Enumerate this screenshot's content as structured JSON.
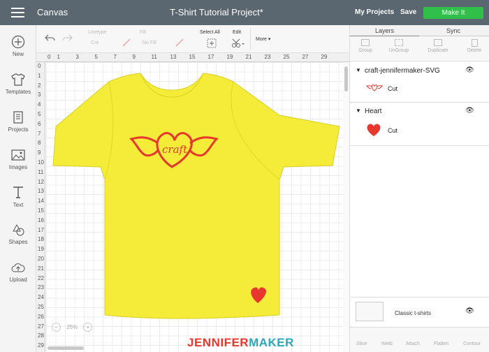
{
  "topbar": {
    "app_title": "Canvas",
    "project_title": "T-Shirt Tutorial Project*",
    "my_projects": "My Projects",
    "save": "Save",
    "make_it": "Make It"
  },
  "sidebar": {
    "items": [
      {
        "label": "New",
        "icon": "plus-circle-icon"
      },
      {
        "label": "Templates",
        "icon": "tshirt-icon"
      },
      {
        "label": "Projects",
        "icon": "book-icon"
      },
      {
        "label": "Images",
        "icon": "image-icon"
      },
      {
        "label": "Text",
        "icon": "text-icon"
      },
      {
        "label": "Shapes",
        "icon": "shapes-icon"
      },
      {
        "label": "Upload",
        "icon": "cloud-upload-icon"
      }
    ]
  },
  "toolbar": {
    "linetype_label": "Linetype",
    "linetype_value": "Cut",
    "fill_label": "Fill",
    "fill_value": "No Fill",
    "select_all": "Select All",
    "edit": "Edit",
    "more": "More"
  },
  "ruler": {
    "top": [
      "0",
      "1",
      "",
      "3",
      "",
      "5",
      "",
      "7",
      "",
      "9",
      "",
      "11",
      "",
      "13",
      "",
      "15",
      "",
      "17",
      "",
      "19",
      "",
      "21",
      "",
      "23",
      "",
      "25",
      "",
      "27",
      "",
      "29",
      ""
    ],
    "left": [
      "0",
      "1",
      "2",
      "3",
      "4",
      "5",
      "6",
      "7",
      "8",
      "9",
      "10",
      "11",
      "12",
      "13",
      "14",
      "15",
      "16",
      "17",
      "18",
      "19",
      "20",
      "21",
      "22",
      "23",
      "24",
      "25",
      "26",
      "27",
      "28",
      "29"
    ]
  },
  "canvas": {
    "shirt_color": "#f5ec3a",
    "design_color": "#e8382e",
    "zoom": "25%"
  },
  "panel": {
    "tabs": [
      {
        "label": "Layers",
        "active": true
      },
      {
        "label": "Sync",
        "active": false
      }
    ],
    "tools": [
      "Group",
      "UnGroup",
      "Duplicate",
      "Delete"
    ],
    "layers": [
      {
        "name": "craft-jennifermaker-SVG",
        "child": "Cut"
      },
      {
        "name": "Heart",
        "child": "Cut"
      }
    ],
    "canvas_layer": "Classic t-shirts",
    "footer_tools": [
      "Slice",
      "Weld",
      "Attach",
      "Flatten",
      "Contour"
    ]
  },
  "branding": {
    "part1": "JENNIFER",
    "part2": "MAKER",
    "color1": "#e8382e",
    "color2": "#2aa9b8"
  }
}
